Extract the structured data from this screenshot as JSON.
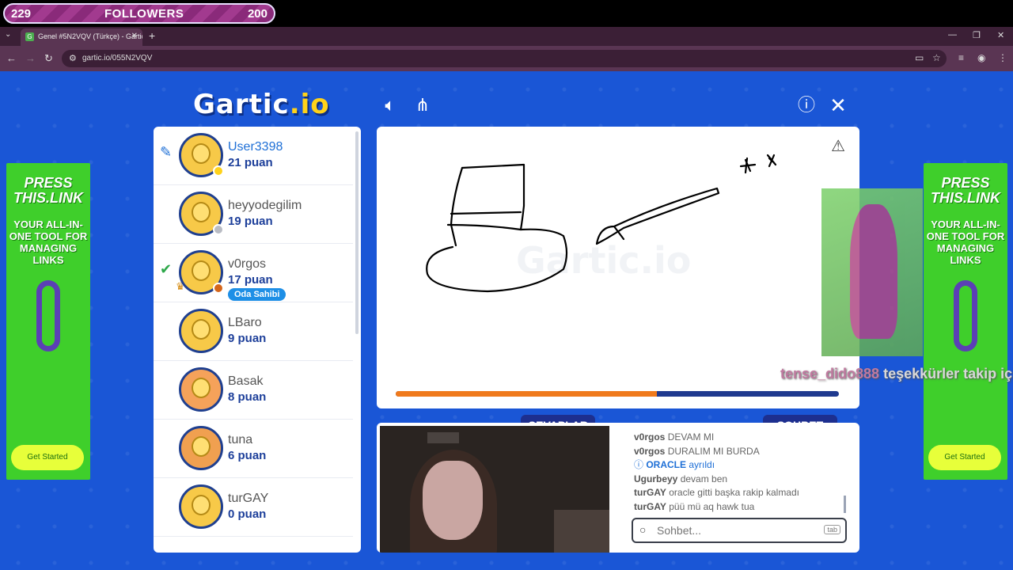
{
  "followers": {
    "current": "229",
    "label": "FOLLOWERS",
    "goal": "200"
  },
  "browser": {
    "tab_title": "Genel #5N2VQV (Türkçe) - Gartic",
    "url": "gartic.io/055N2VQV"
  },
  "logo": {
    "main": "Gartic",
    "suffix": ".io"
  },
  "players": [
    {
      "name": "User3398",
      "score": "21 puan",
      "status_color": "#ffd21a",
      "drawing": true,
      "avatar_color": "#f7c948"
    },
    {
      "name": "heyyodegilim",
      "score": "19 puan",
      "status_color": "#b9bcc4",
      "avatar_color": "#f7c948"
    },
    {
      "name": "v0rgos",
      "score": "17 puan",
      "status_color": "#d4651a",
      "guessed": true,
      "owner": "Oda Sahibi",
      "avatar_color": "#f7c948"
    },
    {
      "name": "LBaro",
      "score": "9 puan",
      "avatar_color": "#f7c948"
    },
    {
      "name": "Basak",
      "score": "8 puan",
      "avatar_color": "#f5a25a"
    },
    {
      "name": "tuna",
      "score": "6 puan",
      "avatar_color": "#f0a050"
    },
    {
      "name": "turGAY",
      "score": "0 puan",
      "avatar_color": "#f7c948"
    }
  ],
  "canvas": {
    "watermark": "Gartic.io",
    "progress": 0.59
  },
  "tabs": {
    "answers": "CEVAPLAR",
    "chat": "SOHBET"
  },
  "chat": {
    "messages": [
      {
        "user": "v0rgos",
        "text": "DEVAM MI"
      },
      {
        "user": "v0rgos",
        "text": "DURALIM MI BURDA"
      },
      {
        "system": true,
        "user": "ORACLE",
        "text": "ayrıldı"
      },
      {
        "user": "Ugurbeyy",
        "text": "devam ben"
      },
      {
        "user": "turGAY",
        "text": "oracle gitti başka rakip kalmadı"
      },
      {
        "user": "turGAY",
        "text": "püü mü aq hawk tua"
      }
    ],
    "input_placeholder": "Sohbet...",
    "tab_hint": "tab"
  },
  "ads": {
    "press": "PRESS THIS.LINK",
    "tagline": "YOUR ALL-IN-ONE TOOL FOR MANAGING LINKS",
    "cta": "Get Started"
  },
  "stream_overlay": {
    "name": "tense_dido888",
    "text": "teşekkürler takip için"
  }
}
